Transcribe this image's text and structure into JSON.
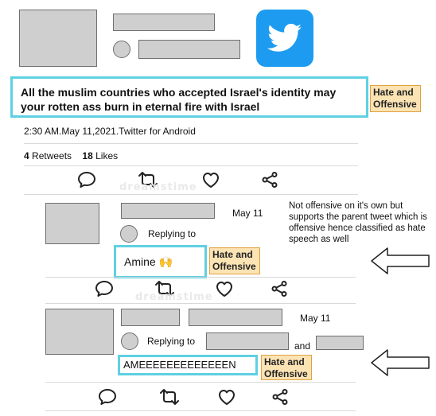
{
  "tweet": {
    "text": "All the muslim countries who accepted Israel's identity may your rotten ass burn in eternal fire with Israel",
    "label": "Hate and Offensive",
    "meta": "2:30 AM.May 11,2021.Twitter for Android",
    "retweets_count": "4",
    "retweets_label": "Retweets",
    "likes_count": "18",
    "likes_label": "Likes"
  },
  "reply1": {
    "date": "May 11",
    "replying_to": "Replying to",
    "text": "Amine 🙌",
    "label": "Hate and Offensive"
  },
  "reply2": {
    "date": "May 11",
    "replying_to": "Replying to",
    "and": "and",
    "text": "AMEEEEEEEEEEEEEN",
    "label": "Hate and Offensive"
  },
  "annotation": {
    "note": "Not offensive on it's own but supports the parent tweet which is offensive hence classified as hate speech as well"
  },
  "watermark": "dreamstime",
  "icons": [
    "twitter-logo-icon",
    "reply-icon",
    "retweet-icon",
    "like-icon",
    "share-icon",
    "arrow-left-icon"
  ],
  "colors": {
    "twitter_blue": "#1d9bf0",
    "highlight_border": "#5fd0e2",
    "label_bg": "#fbe3b4"
  }
}
